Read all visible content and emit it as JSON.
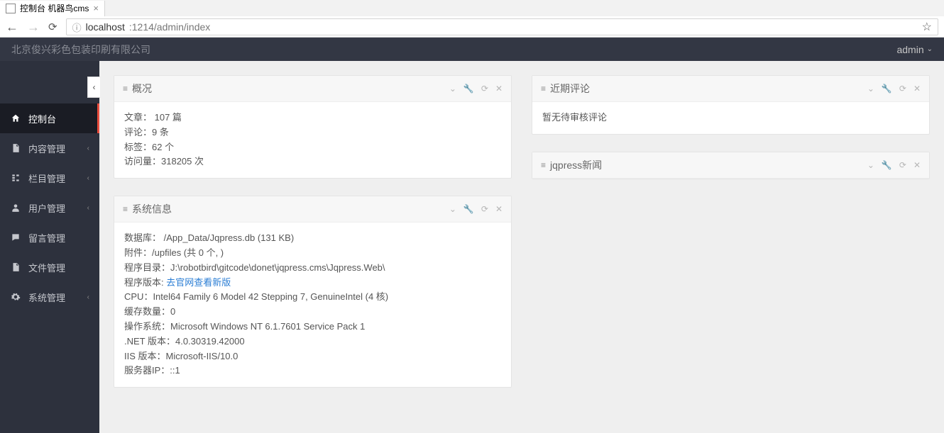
{
  "browser": {
    "tab_title": "控制台 机器鸟cms",
    "url_host": "localhost",
    "url_rest": ":1214/admin/index"
  },
  "header": {
    "company": "北京俊兴彩色包装印刷有限公司",
    "user": "admin"
  },
  "sidebar": {
    "items": [
      {
        "icon": "home",
        "label": "控制台",
        "active": true
      },
      {
        "icon": "doc",
        "label": "内容管理",
        "expandable": true
      },
      {
        "icon": "tree",
        "label": "栏目管理",
        "expandable": true
      },
      {
        "icon": "user",
        "label": "用户管理",
        "expandable": true
      },
      {
        "icon": "comment",
        "label": "留言管理"
      },
      {
        "icon": "doc",
        "label": "文件管理"
      },
      {
        "icon": "gear",
        "label": "系统管理",
        "expandable": true
      }
    ]
  },
  "panels": {
    "overview": {
      "title": "概况",
      "lines": {
        "articles": "文章： 107 篇",
        "comments": "评论：9 条",
        "tags": "标签：62 个",
        "visits": "访问量：318205 次"
      }
    },
    "recent_comments": {
      "title": "近期评论",
      "empty": "暂无待审核评论"
    },
    "sysinfo": {
      "title": "系统信息",
      "db": "数据库： /App_Data/Jqpress.db (131 KB)",
      "files": "附件：/upfiles (共 0 个, )",
      "path": "程序目录：J:\\robotbird\\gitcode\\donet\\jqpress.cms\\Jqpress.Web\\",
      "ver_label": "程序版本: ",
      "ver_link": "去官网查看新版",
      "cpu": "CPU：Intel64 Family 6 Model 42 Stepping 7, GenuineIntel (4 核)",
      "cache": "缓存数量：0",
      "os": "操作系统：Microsoft Windows NT 6.1.7601 Service Pack 1",
      "dotnet": ".NET 版本：4.0.30319.42000",
      "iis": "IIS 版本：Microsoft-IIS/10.0",
      "ip": "服务器IP：::1"
    },
    "news": {
      "title": "jqpress新闻"
    }
  }
}
